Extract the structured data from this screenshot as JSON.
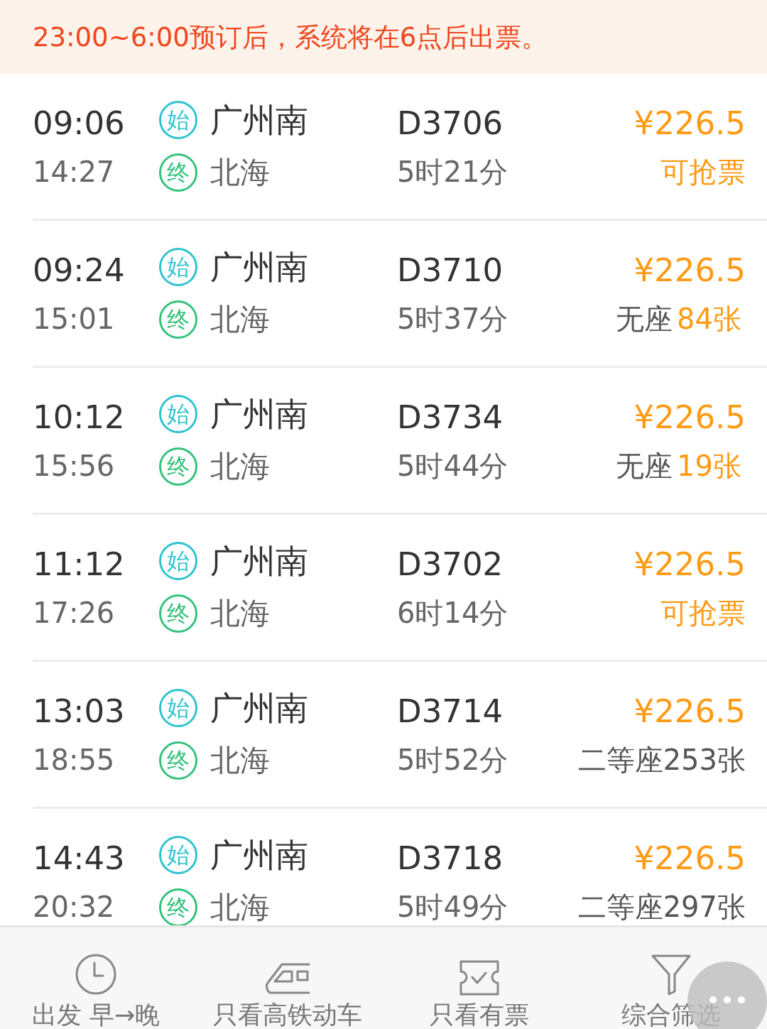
{
  "notice": "23:00~6:00预订后，系统将在6点后出票。",
  "trains": [
    {
      "depart": "09:06",
      "arrive": "14:27",
      "from_badge": "始",
      "from": "广州南",
      "to_badge": "终",
      "to": "北海",
      "number": "D3706",
      "duration": "5时21分",
      "price": "¥226.5",
      "availability": {
        "kind": "grab",
        "text": "可抢票"
      }
    },
    {
      "depart": "09:24",
      "arrive": "15:01",
      "from_badge": "始",
      "from": "广州南",
      "to_badge": "终",
      "to": "北海",
      "number": "D3710",
      "duration": "5时37分",
      "price": "¥226.5",
      "availability": {
        "kind": "seat",
        "label": "无座",
        "count": "84张"
      }
    },
    {
      "depart": "10:12",
      "arrive": "15:56",
      "from_badge": "始",
      "from": "广州南",
      "to_badge": "终",
      "to": "北海",
      "number": "D3734",
      "duration": "5时44分",
      "price": "¥226.5",
      "availability": {
        "kind": "seat",
        "label": "无座",
        "count": "19张"
      }
    },
    {
      "depart": "11:12",
      "arrive": "17:26",
      "from_badge": "始",
      "from": "广州南",
      "to_badge": "终",
      "to": "北海",
      "number": "D3702",
      "duration": "6时14分",
      "price": "¥226.5",
      "availability": {
        "kind": "grab",
        "text": "可抢票"
      }
    },
    {
      "depart": "13:03",
      "arrive": "18:55",
      "from_badge": "始",
      "from": "广州南",
      "to_badge": "终",
      "to": "北海",
      "number": "D3714",
      "duration": "5时52分",
      "price": "¥226.5",
      "availability": {
        "kind": "plain",
        "text": "二等座253张"
      }
    },
    {
      "depart": "14:43",
      "arrive": "20:32",
      "from_badge": "始",
      "from": "广州南",
      "to_badge": "终",
      "to": "北海",
      "number": "D3718",
      "duration": "5时49分",
      "price": "¥226.5",
      "availability": {
        "kind": "plain",
        "text": "二等座297张"
      }
    }
  ],
  "toolbar": [
    {
      "kind": "clock",
      "label": "出发 早→晚"
    },
    {
      "kind": "train",
      "label": "只看高铁动车"
    },
    {
      "kind": "ticket",
      "label": "只看有票"
    },
    {
      "kind": "filter",
      "label": "综合筛选"
    }
  ]
}
